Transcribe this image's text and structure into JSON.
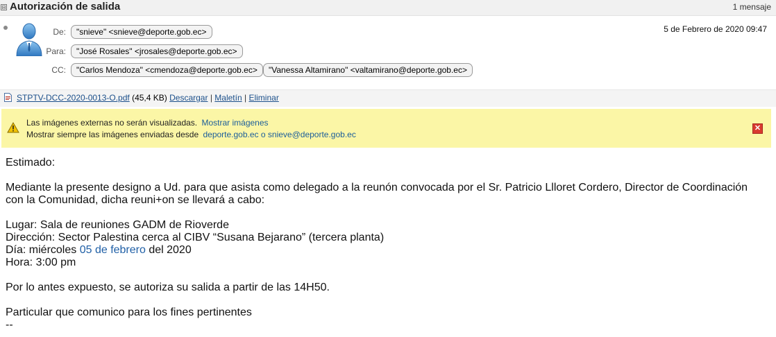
{
  "conversation": {
    "toggle": "⊟",
    "title": "Autorización de salida",
    "count": "1 mensaje"
  },
  "message": {
    "date": "5 de Febrero de 2020 09:47",
    "from_label": "De:",
    "from": "\"snieve\" <snieve@deporte.gob.ec>",
    "to_label": "Para:",
    "to": "\"José Rosales\" <jrosales@deporte.gob.ec>",
    "cc_label": "CC:",
    "cc": [
      "\"Carlos Mendoza\" <cmendoza@deporte.gob.ec>",
      "\"Vanessa Altamirano\" <valtamirano@deporte.gob.ec>"
    ]
  },
  "attachment": {
    "filename": "STPTV-DCC-2020-0013-O.pdf",
    "size": "(45,4 KB)",
    "download": "Descargar",
    "briefcase": "Maletín",
    "delete": "Eliminar",
    "separator": "|"
  },
  "warning": {
    "line1": "Las imágenes externas no serán visualizadas.",
    "show_images": "Mostrar imágenes",
    "line2": "Mostrar siempre las imágenes enviadas desde",
    "domain": "deporte.gob.ec",
    "or": "o",
    "sender": "snieve@deporte.gob.ec",
    "close": "✕"
  },
  "body": {
    "greeting": "Estimado:",
    "para1_line1": "Mediante la presente designo a Ud. para que asista como delegado a la reunón convocada por el Sr. Patricio Llloret Cordero, Director de Coordinación",
    "para1_line2": "con la Comunidad, dicha reuni+on se llevará a cabo:",
    "lugar": "Lugar: Sala de reuniones GADM de Rioverde",
    "direccion": "Dirección: Sector Palestina cerca al CIBV “Susana Bejarano” (tercera planta)",
    "dia_prefix": "Día: miércoles ",
    "dia_date": "05 de febrero",
    "dia_suffix": " del 2020",
    "hora": "Hora: 3:00 pm",
    "para2": "Por lo antes expuesto, se autoriza su salida a partir de las 14H50.",
    "closing": "Particular que comunico para los fines pertinentes",
    "signature_sep": "--"
  }
}
